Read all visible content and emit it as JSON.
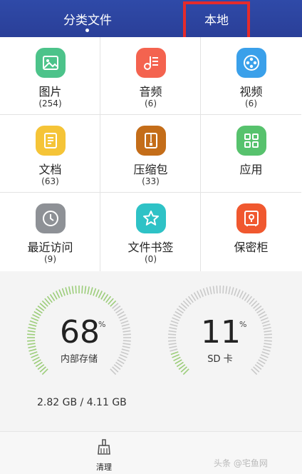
{
  "header": {
    "tabs": [
      {
        "label": "分类文件",
        "active": true
      },
      {
        "label": "本地",
        "active": false
      }
    ]
  },
  "categories": [
    {
      "label": "图片",
      "count": "(254)",
      "icon": "image-icon",
      "color": "#4cc38a"
    },
    {
      "label": "音频",
      "count": "(6)",
      "icon": "music-note-icon",
      "color": "#f4634f"
    },
    {
      "label": "视频",
      "count": "(6)",
      "icon": "film-reel-icon",
      "color": "#3aa0ea"
    },
    {
      "label": "文档",
      "count": "(63)",
      "icon": "document-icon",
      "color": "#f5c437"
    },
    {
      "label": "压缩包",
      "count": "(33)",
      "icon": "archive-icon",
      "color": "#c46d19"
    },
    {
      "label": "应用",
      "count": "",
      "icon": "apps-grid-icon",
      "color": "#57c26d"
    },
    {
      "label": "最近访问",
      "count": "(9)",
      "icon": "clock-icon",
      "color": "#8e9196"
    },
    {
      "label": "文件书签",
      "count": "(0)",
      "icon": "star-icon",
      "color": "#2ec2c6"
    },
    {
      "label": "保密柜",
      "count": "",
      "icon": "safe-icon",
      "color": "#f0582f"
    }
  ],
  "storage": {
    "internal": {
      "value": "68",
      "unit": "%",
      "label": "内部存储",
      "fraction": 0.68,
      "color": "#9ccd7a"
    },
    "sd": {
      "value": "11",
      "unit": "%",
      "label": "SD 卡",
      "fraction": 0.11,
      "color": "#9ccd7a"
    },
    "size_text": "2.82 GB / 4.11 GB"
  },
  "bottom": {
    "clean_label": "清理"
  },
  "watermark": "头条 @宅鱼网"
}
